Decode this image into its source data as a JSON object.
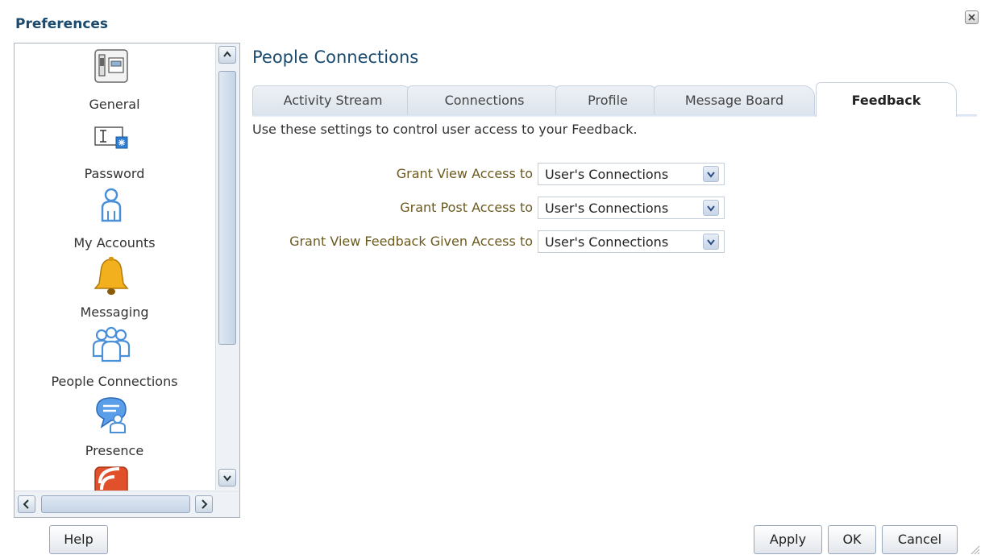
{
  "window": {
    "title": "Preferences"
  },
  "nav": {
    "items": [
      {
        "label": "General",
        "icon": "general-settings-icon"
      },
      {
        "label": "Password",
        "icon": "password-icon"
      },
      {
        "label": "My Accounts",
        "icon": "person-icon"
      },
      {
        "label": "Messaging",
        "icon": "bell-icon"
      },
      {
        "label": "People Connections",
        "icon": "people-group-icon"
      },
      {
        "label": "Presence",
        "icon": "presence-icon"
      },
      {
        "label": "",
        "icon": "rss-feed-icon"
      }
    ]
  },
  "main": {
    "section_title": "People Connections",
    "tabs": [
      {
        "label": "Activity Stream"
      },
      {
        "label": "Connections"
      },
      {
        "label": "Profile"
      },
      {
        "label": "Message Board"
      },
      {
        "label": "Feedback",
        "active": true
      }
    ],
    "description": "Use these settings to control user access to your Feedback.",
    "settings": [
      {
        "label": "Grant View Access to",
        "value": "User's Connections"
      },
      {
        "label": "Grant Post Access to",
        "value": "User's Connections"
      },
      {
        "label": "Grant View Feedback Given Access to",
        "value": "User's Connections"
      }
    ]
  },
  "footer": {
    "help_label": "Help",
    "apply_label": "Apply",
    "ok_label": "OK",
    "cancel_label": "Cancel"
  },
  "colors": {
    "title": "#1a4a6e",
    "setting_label": "#6b5a1e",
    "bell": "#f2b01e",
    "people_blue": "#4a90d9",
    "feed_red": "#e0502a"
  }
}
